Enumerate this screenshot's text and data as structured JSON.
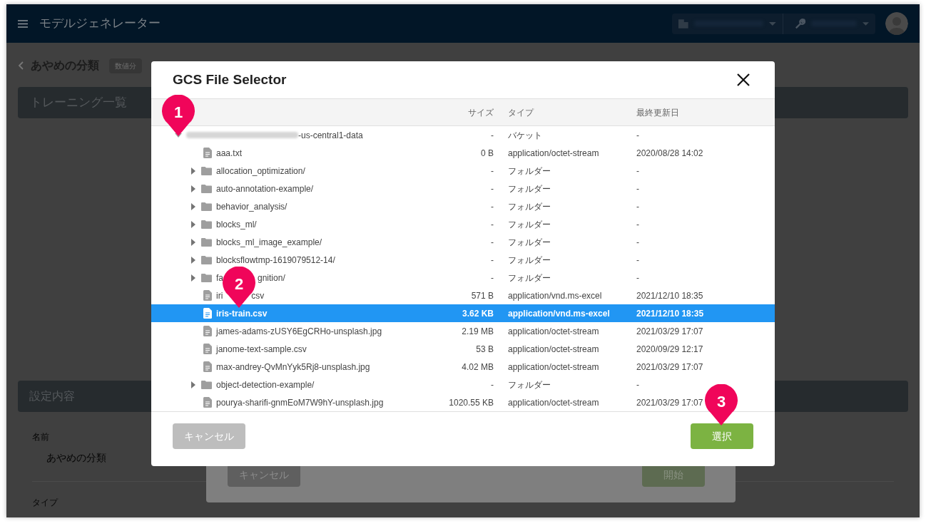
{
  "app_bar": {
    "title": "モデルジェネレーター"
  },
  "page": {
    "title": "あやめの分類",
    "tag": "数値分",
    "sections": [
      {
        "title": "トレーニング一覧"
      },
      {
        "title": "設定内容"
      }
    ],
    "fields": [
      {
        "label": "名前",
        "value": "あやめの分類"
      },
      {
        "label": "タイプ"
      }
    ]
  },
  "underlying_dialog": {
    "buttons": [
      {
        "label": "キャンセル",
        "kind": "secondary"
      },
      {
        "label": "開始",
        "kind": "primary"
      }
    ]
  },
  "dialog": {
    "title": "GCS File Selector",
    "columns": [
      "サイズ",
      "タイプ",
      "最終更新日"
    ],
    "rows": [
      {
        "kind": "bucket",
        "name": "-us-central1-data",
        "redacted": true,
        "expanded": true,
        "selected": false,
        "size": "-",
        "type": "バケット",
        "modified": "-",
        "children": [
          {
            "kind": "file",
            "name": "aaa.txt",
            "selected": false,
            "size": "0 B",
            "type": "application/octet-stream",
            "modified": "2020/08/28 14:02"
          },
          {
            "kind": "folder",
            "name": "allocation_optimization/",
            "expanded": false,
            "selected": false,
            "size": "-",
            "type": "フォルダー",
            "modified": "-"
          },
          {
            "kind": "folder",
            "name": "auto-annotation-example/",
            "expanded": false,
            "selected": false,
            "size": "-",
            "type": "フォルダー",
            "modified": "-"
          },
          {
            "kind": "folder",
            "name": "behavior_analysis/",
            "expanded": false,
            "selected": false,
            "size": "-",
            "type": "フォルダー",
            "modified": "-"
          },
          {
            "kind": "folder",
            "name": "blocks_ml/",
            "expanded": false,
            "selected": false,
            "size": "-",
            "type": "フォルダー",
            "modified": "-"
          },
          {
            "kind": "folder",
            "name": "blocks_ml_image_example/",
            "expanded": false,
            "selected": false,
            "size": "-",
            "type": "フォルダー",
            "modified": "-"
          },
          {
            "kind": "folder",
            "name": "blocksflowtmp-1619079512-14/",
            "expanded": false,
            "selected": false,
            "size": "-",
            "type": "フォルダー",
            "modified": "-"
          },
          {
            "kind": "folder",
            "name_parts": [
              "fa",
              "gnition/"
            ],
            "expanded": false,
            "selected": false,
            "size": "-",
            "type": "フォルダー",
            "modified": "-"
          },
          {
            "kind": "file",
            "name_parts": [
              "iri",
              "csv"
            ],
            "selected": false,
            "size": "571 B",
            "type": "application/vnd.ms-excel",
            "modified": "2021/12/10 18:35"
          },
          {
            "kind": "file",
            "name": "iris-train.csv",
            "selected": true,
            "size": "3.62 KB",
            "type": "application/vnd.ms-excel",
            "modified": "2021/12/10 18:35"
          },
          {
            "kind": "file",
            "name": "james-adams-zUSY6EgCRHo-unsplash.jpg",
            "selected": false,
            "size": "2.19 MB",
            "type": "application/octet-stream",
            "modified": "2021/03/29 17:07"
          },
          {
            "kind": "file",
            "name": "janome-text-sample.csv",
            "selected": false,
            "size": "53 B",
            "type": "application/octet-stream",
            "modified": "2020/09/29 12:17"
          },
          {
            "kind": "file",
            "name": "max-andrey-QvMnYyk5Rj8-unsplash.jpg",
            "selected": false,
            "size": "4.02 MB",
            "type": "application/octet-stream",
            "modified": "2021/03/29 17:07"
          },
          {
            "kind": "folder",
            "name": "object-detection-example/",
            "expanded": false,
            "selected": false,
            "size": "-",
            "type": "フォルダー",
            "modified": "-"
          },
          {
            "kind": "file",
            "name": "pourya-sharifi-gnmEoM7W9hY-unsplash.jpg",
            "selected": false,
            "size": "1020.55 KB",
            "type": "application/octet-stream",
            "modified": "2021/03/29 17:07"
          }
        ]
      }
    ],
    "buttons": [
      {
        "label": "キャンセル",
        "kind": "secondary"
      },
      {
        "label": "選択",
        "kind": "primary"
      }
    ]
  },
  "callouts": [
    {
      "number": "1"
    },
    {
      "number": "2"
    },
    {
      "number": "3"
    }
  ]
}
